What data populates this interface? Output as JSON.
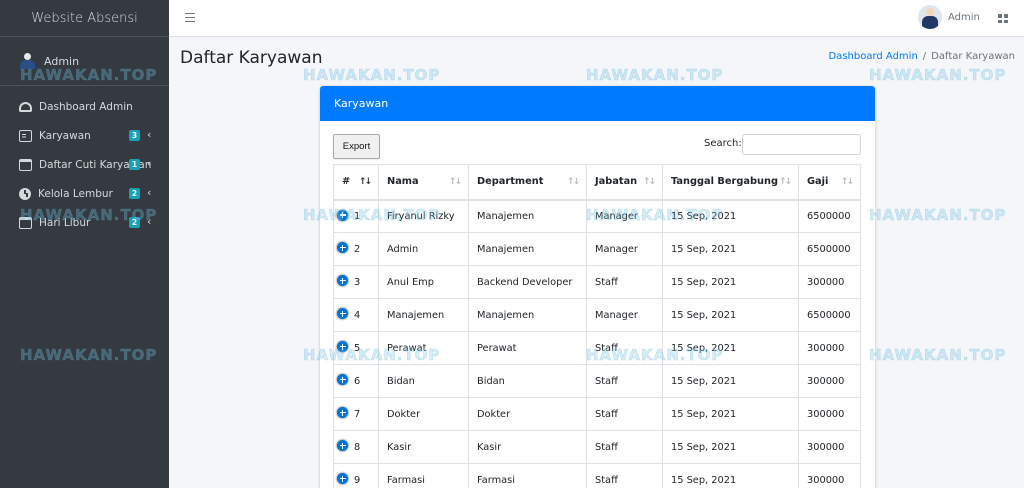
{
  "brand": "Website Absensi",
  "sidebar": {
    "user": "Admin",
    "items": [
      {
        "label": "Dashboard Admin",
        "icon": "tachometer-icon"
      },
      {
        "label": "Karyawan",
        "icon": "id-card-icon",
        "badge": "3"
      },
      {
        "label": "Daftar Cuti Karyawan",
        "icon": "calendar-check-icon",
        "badge": "1"
      },
      {
        "label": "Kelola Lembur",
        "icon": "clock-icon",
        "badge": "2"
      },
      {
        "label": "Hari Libur",
        "icon": "calendar-minus-icon",
        "badge": "2"
      }
    ]
  },
  "topbar": {
    "user": "Admin"
  },
  "header": {
    "title": "Daftar Karyawan",
    "breadcrumb": {
      "home": "Dashboard Admin",
      "separator": "/",
      "current": "Daftar Karyawan"
    }
  },
  "card": {
    "title": "Karyawan",
    "export_label": "Export",
    "search_label": "Search:"
  },
  "table": {
    "columns": [
      "#",
      "Nama",
      "Department",
      "Jabatan",
      "Tanggal Bergabung",
      "Gaji"
    ],
    "rows": [
      [
        "1",
        "Firyanul Rizky",
        "Manajemen",
        "Manager",
        "15 Sep, 2021",
        "6500000"
      ],
      [
        "2",
        "Admin",
        "Manajemen",
        "Manager",
        "15 Sep, 2021",
        "6500000"
      ],
      [
        "3",
        "Anul Emp",
        "Backend Developer",
        "Staff",
        "15 Sep, 2021",
        "300000"
      ],
      [
        "4",
        "Manajemen",
        "Manajemen",
        "Manager",
        "15 Sep, 2021",
        "6500000"
      ],
      [
        "5",
        "Perawat",
        "Perawat",
        "Staff",
        "15 Sep, 2021",
        "300000"
      ],
      [
        "6",
        "Bidan",
        "Bidan",
        "Staff",
        "15 Sep, 2021",
        "300000"
      ],
      [
        "7",
        "Dokter",
        "Dokter",
        "Staff",
        "15 Sep, 2021",
        "300000"
      ],
      [
        "8",
        "Kasir",
        "Kasir",
        "Staff",
        "15 Sep, 2021",
        "300000"
      ],
      [
        "9",
        "Farmasi",
        "Farmasi",
        "Staff",
        "15 Sep, 2021",
        "300000"
      ]
    ]
  },
  "watermark": "HAWAKAN.TOP",
  "colors": {
    "sidebar": "#343a40",
    "primary": "#007bff",
    "badge": "#17a2b8"
  }
}
